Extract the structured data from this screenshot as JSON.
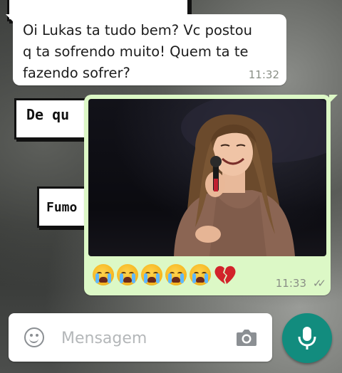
{
  "wallpaper": {
    "sticker_top_text": "",
    "sticker_one_text": "De qu",
    "sticker_two_text": "Fumo"
  },
  "messages": [
    {
      "direction": "incoming",
      "text": "Oi Lukas ta tudo bem? Vc postou\nq ta sofrendo muito!  Quem ta te\nfazendo sofrer?",
      "time": "11:32"
    },
    {
      "direction": "outgoing",
      "emojis": [
        "loudly-crying-face",
        "loudly-crying-face",
        "loudly-crying-face",
        "loudly-crying-face",
        "loudly-crying-face",
        "broken-heart"
      ],
      "time": "11:33",
      "status_icon": "double-check-icon",
      "status_ticks": "✓✓"
    }
  ],
  "composer": {
    "placeholder": "Mensagem",
    "value": ""
  },
  "icons": {
    "emoji_button": "smiley-icon",
    "camera_button": "camera-icon",
    "send_button": "microphone-icon"
  },
  "colors": {
    "incoming_bubble": "#ffffff",
    "outgoing_bubble": "#dcf8c6",
    "mic_button": "#128c7e",
    "timestamp": "#8a8f86"
  }
}
